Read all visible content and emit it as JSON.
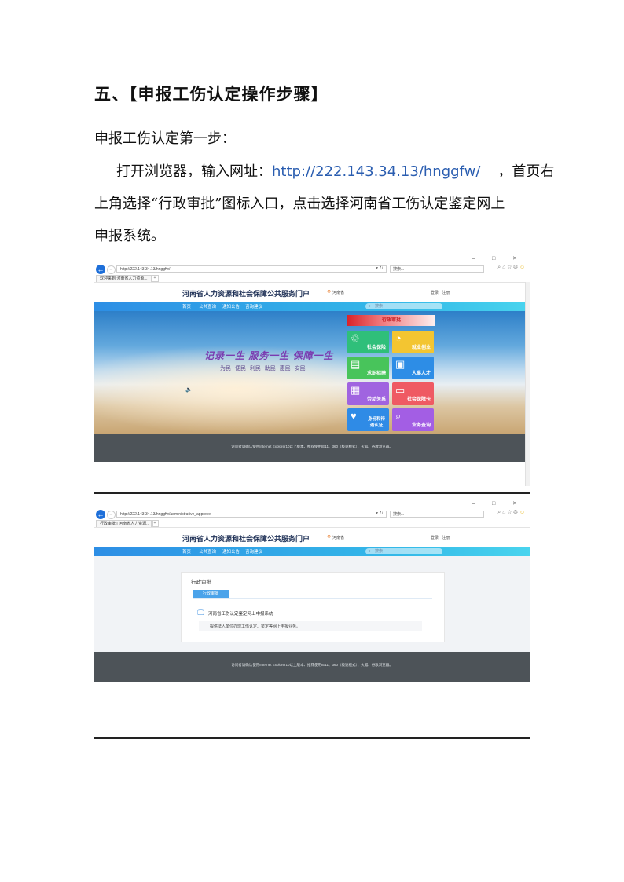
{
  "doc": {
    "heading": "五、【申报工伤认定操作步骤】",
    "step_label": "申报工伤认定第一步：",
    "line1_prefix": "打开浏览器，输入网址：",
    "url_link": "http://222.143.34.13/hnggfw/",
    "line1_suffix": "，首页右",
    "line2": "上角选择“行政审批”图标入口，点击选择河南省工伤认定鉴定网上",
    "line3": "申报系统。"
  },
  "browser1": {
    "url": "http://222.143.34.13/hnggfw/",
    "search_placeholder": "搜索...",
    "tab_title": "欢迎来到 河南省人力资源..."
  },
  "browser2": {
    "url": "http://222.143.34.13/hnggfw/administrative_approve",
    "search_placeholder": "搜索...",
    "tab_title": "行政审批 | 河南省人力资源..."
  },
  "site": {
    "portal_title": "河南省人力资源和社会保障公共服务门户",
    "region": "河南省",
    "auth": "登录 注册",
    "nav": [
      "首页",
      "公共查询",
      "通知公告",
      "咨询建议"
    ],
    "search_placeholder": "搜索",
    "hero_slogan": "记录一生 服务一生 保障一生",
    "hero_sub": "为民 便民 利民 助民 惠民 安民",
    "admin_banner": "行政审批",
    "tiles": [
      "社会保险",
      "就业创业",
      "求职招聘",
      "人事人才",
      "劳动关系",
      "社会保障卡",
      "身份和待遇认证",
      "业务查询"
    ],
    "footer_text": "访问者请确认使用Internet Explorer10以上版本、推荐使用IE11、360（极速模式）、火狐、谷歌浏览器。",
    "card_title": "行政审批",
    "card_tab": "行政审批",
    "item_title": "河南省工伤认定鉴定网上申报系统",
    "item_desc": "提供法人单位办理工伤认定、鉴定等网上申报业务。"
  },
  "colors": {
    "link": "#2a5db0",
    "nav_start": "#2d8ee5",
    "footer": "#4d5358",
    "tiles": [
      "#2fbf7a",
      "#f3c531",
      "#48c45b",
      "#2d8de6",
      "#a064e0",
      "#ef5a63",
      "#2f8be6",
      "#a35ee4"
    ]
  },
  "icons": [
    "back-arrow-icon",
    "forward-arrow-icon",
    "refresh-icon",
    "search-icon",
    "home-icon",
    "star-icon",
    "gear-icon",
    "smiley-icon",
    "location-pin-icon",
    "speaker-icon",
    "monitor-icon"
  ]
}
